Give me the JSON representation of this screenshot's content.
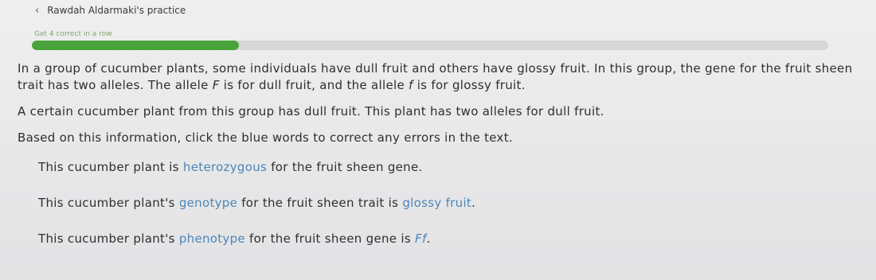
{
  "header": {
    "back_label": "Rawdah Aldarmaki's practice"
  },
  "progress": {
    "label": "Get 4 correct in a row",
    "fraction": 0.26
  },
  "question": {
    "intro": {
      "p1": "In a group of cucumber plants, some individuals have dull fruit and others have glossy fruit. In this group, the gene for the fruit sheen trait has two alleles. The allele ",
      "allele_upper": "F",
      "p2": " is for dull fruit, and the allele ",
      "allele_lower": "f",
      "p3": " is for glossy fruit."
    },
    "context": "A certain cucumber plant from this group has dull fruit. This plant has two alleles for dull fruit.",
    "instruction": "Based on this information, click the blue words to correct any errors in the text.",
    "statements": [
      {
        "before": "This cucumber plant is ",
        "blue": "heterozygous",
        "after": " for the fruit sheen gene."
      },
      {
        "before": "This cucumber plant's ",
        "blue": "genotype",
        "middle": " for the fruit sheen trait is ",
        "blue2": "glossy fruit",
        "after": "."
      },
      {
        "before": "This cucumber plant's ",
        "blue": "phenotype",
        "middle": " for the fruit sheen gene is ",
        "blue2": "Ff",
        "after": "."
      }
    ]
  },
  "colors": {
    "accent_blue": "#4d86b8",
    "progress_green": "#4aa33a"
  }
}
